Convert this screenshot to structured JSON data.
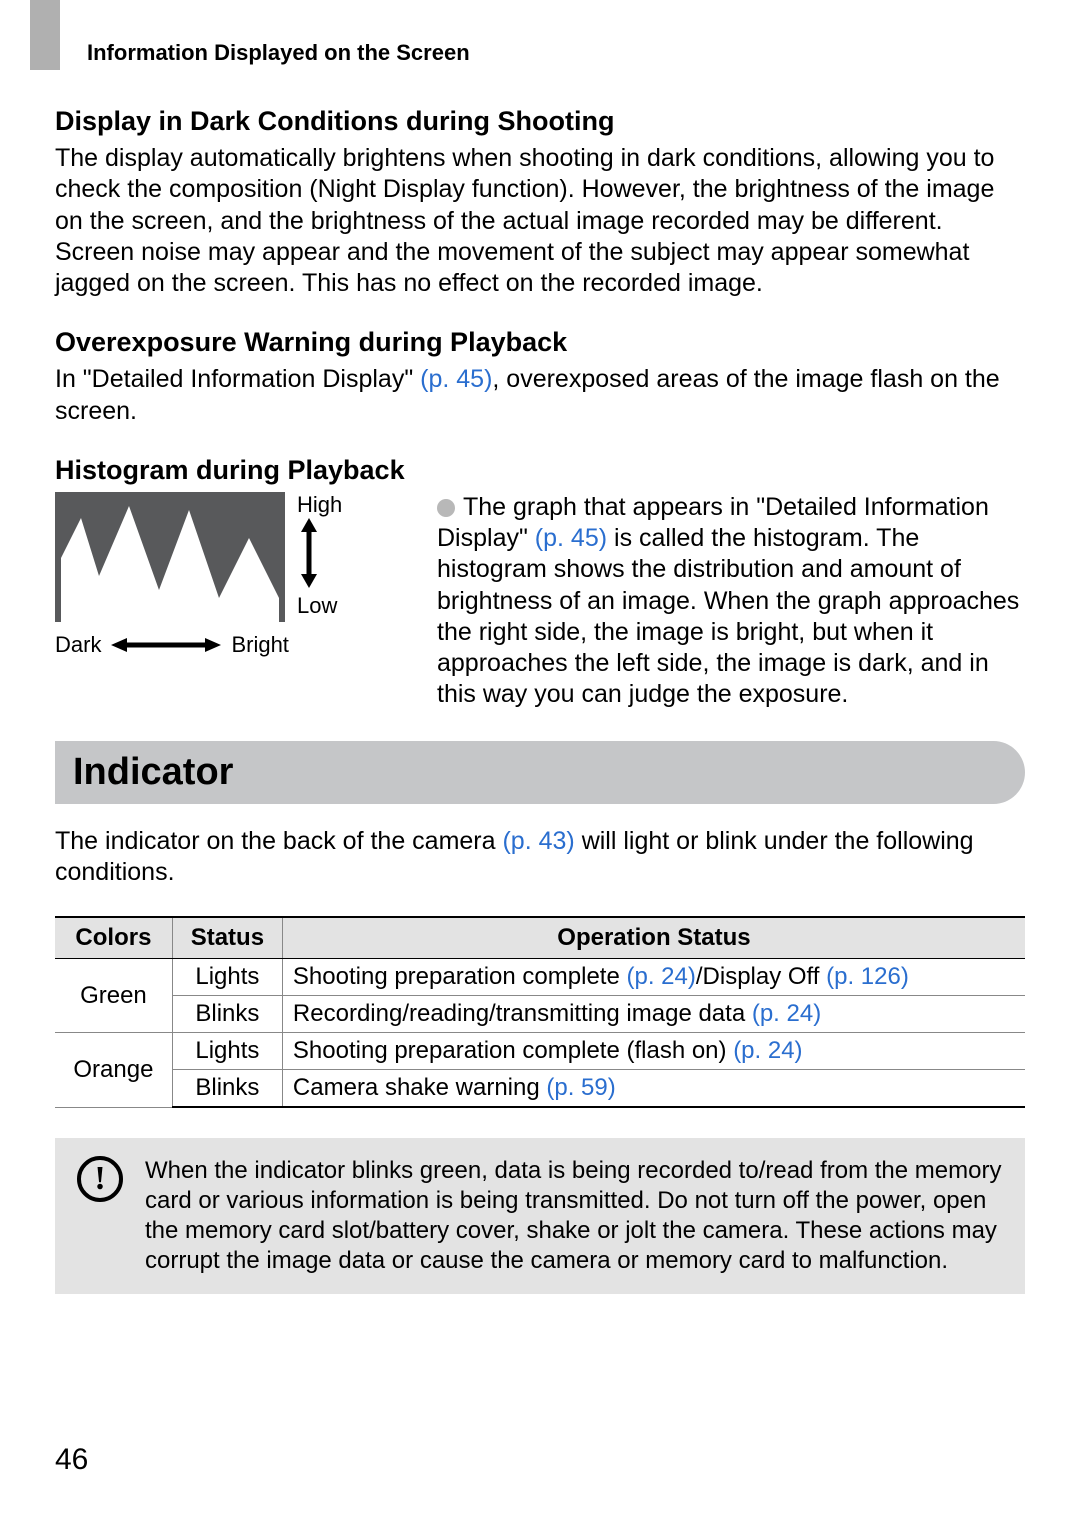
{
  "running_head": "Information Displayed on the Screen",
  "section1": {
    "title": "Display in Dark Conditions during Shooting",
    "body": "The display automatically brightens when shooting in dark conditions, allowing you to check the composition (Night Display function). However, the brightness of the image on the screen, and the brightness of the actual image recorded may be different. Screen noise may appear and the movement of the subject may appear somewhat jagged on the screen. This has no effect on the recorded image."
  },
  "section2": {
    "title": "Overexposure Warning during Playback",
    "body_pre": "In \"Detailed Information Display\" ",
    "link": "(p. 45)",
    "body_post": ", overexposed areas of the image flash on the screen."
  },
  "section3": {
    "title": "Histogram during Playback",
    "labels": {
      "high": "High",
      "low": "Low",
      "dark": "Dark",
      "bright": "Bright"
    },
    "body_pre": "The graph that appears in \"Detailed Information Display\" ",
    "link": "(p. 45)",
    "body_post": " is called the histogram. The histogram shows the distribution and amount of brightness of an image. When the graph approaches the right side, the image is bright, but when it approaches the left side, the image is dark, and in this way you can judge the exposure."
  },
  "indicator": {
    "title": "Indicator",
    "intro_pre": "The indicator on the back of the camera ",
    "intro_link": "(p. 43)",
    "intro_post": " will light or blink under the following conditions.",
    "headers": {
      "colors": "Colors",
      "status": "Status",
      "op": "Operation Status"
    },
    "rows": [
      {
        "color": "Green",
        "status": "Lights",
        "op_pre": "Shooting preparation complete ",
        "op_l1": "(p. 24)",
        "op_mid": "/Display Off ",
        "op_l2": "(p. 126)",
        "op_post": ""
      },
      {
        "color": "",
        "status": "Blinks",
        "op_pre": "Recording/reading/transmitting image data ",
        "op_l1": "(p. 24)",
        "op_mid": "",
        "op_l2": "",
        "op_post": ""
      },
      {
        "color": "Orange",
        "status": "Lights",
        "op_pre": "Shooting preparation complete (flash on) ",
        "op_l1": "(p. 24)",
        "op_mid": "",
        "op_l2": "",
        "op_post": ""
      },
      {
        "color": "",
        "status": "Blinks",
        "op_pre": "Camera shake warning ",
        "op_l1": "(p. 59)",
        "op_mid": "",
        "op_l2": "",
        "op_post": ""
      }
    ],
    "note_icon": "!",
    "note": "When the indicator blinks green, data is being recorded to/read from the memory card or various information is being transmitted. Do not turn off the power, open the memory card slot/battery cover, shake or jolt the camera. These actions may corrupt the image data or cause the camera or memory card to malfunction."
  },
  "page_number": "46"
}
